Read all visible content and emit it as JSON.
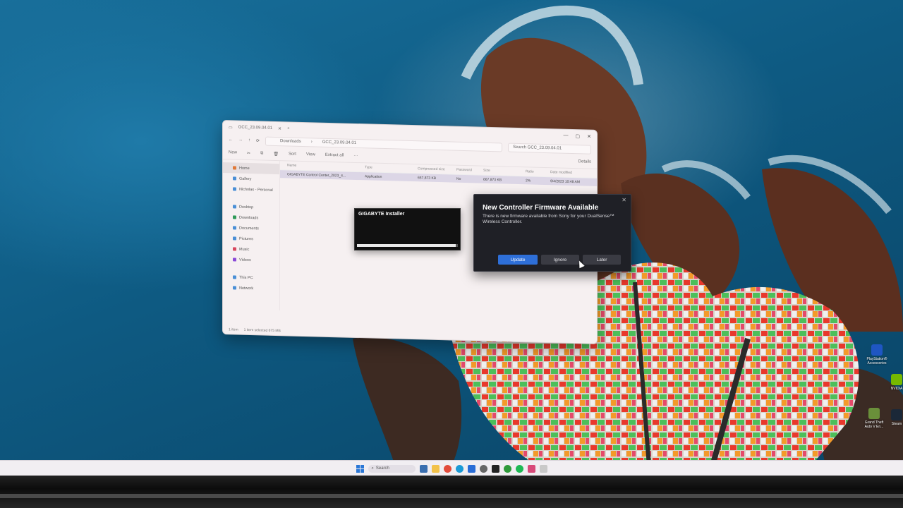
{
  "explorer": {
    "tab_title": "GCC_23.09.04.01",
    "breadcrumb": [
      "Downloads",
      "GCC_23.09.04.01"
    ],
    "search_placeholder": "Search GCC_23.09.04.01",
    "toolbar": [
      "New",
      "Sort",
      "View",
      "Extract all",
      "Details"
    ],
    "nav_items": [
      {
        "label": "Home",
        "icon": "home-icon",
        "active": true
      },
      {
        "label": "Gallery",
        "icon": "gallery-icon"
      },
      {
        "label": "Nicholas - Personal",
        "icon": "onedrive-icon"
      },
      {
        "label": "Desktop",
        "icon": "desktop-icon"
      },
      {
        "label": "Downloads",
        "icon": "download-icon"
      },
      {
        "label": "Documents",
        "icon": "documents-icon"
      },
      {
        "label": "Pictures",
        "icon": "pictures-icon"
      },
      {
        "label": "Music",
        "icon": "music-icon"
      },
      {
        "label": "Videos",
        "icon": "videos-icon"
      },
      {
        "label": "This PC",
        "icon": "pc-icon"
      },
      {
        "label": "Network",
        "icon": "network-icon"
      }
    ],
    "columns": [
      "Name",
      "Type",
      "Compressed size",
      "Password",
      "Size",
      "Ratio",
      "Date modified"
    ],
    "file": {
      "name": "GIGABYTE Control Center_2023_4...",
      "type": "Application",
      "compressed_size": "657,873 KB",
      "password": "No",
      "size": "667,873 KB",
      "ratio": "2%",
      "date": "9/4/2023 10:48 AM"
    },
    "status": [
      "1 item",
      "1 item selected  675 MB"
    ]
  },
  "gigabyte": {
    "title": "GIGABYTE Installer",
    "progress": 0.98
  },
  "firmware_dialog": {
    "title": "New Controller Firmware Available",
    "message": "There is new firmware available from Sony for your DualSense™ Wireless Controller.",
    "buttons": {
      "update": "Update",
      "ignore": "Ignore",
      "later": "Later"
    }
  },
  "desktop_icons": [
    {
      "label": "PlayStation® Accessories",
      "icon": "playstation-icon"
    },
    {
      "label": "NVIDIA",
      "icon": "nvidia-icon"
    },
    {
      "label": "Grand Theft Auto V En...",
      "icon": "gta-icon"
    },
    {
      "label": "Steam",
      "icon": "steam-icon"
    }
  ],
  "taskbar": {
    "search_label": "Search",
    "apps": [
      "widgets-icon",
      "file-explorer-icon",
      "chrome-icon",
      "edge-icon",
      "store-icon",
      "settings-icon",
      "terminal-icon",
      "xbox-icon",
      "spotify-icon",
      "photos-icon",
      "gigabyte-icon"
    ]
  },
  "colors": {
    "accent": "#2e6fd8",
    "dialog_bg": "#1f2026",
    "explorer_bg": "#f6f0f1",
    "ocean": "#0e5a82"
  }
}
